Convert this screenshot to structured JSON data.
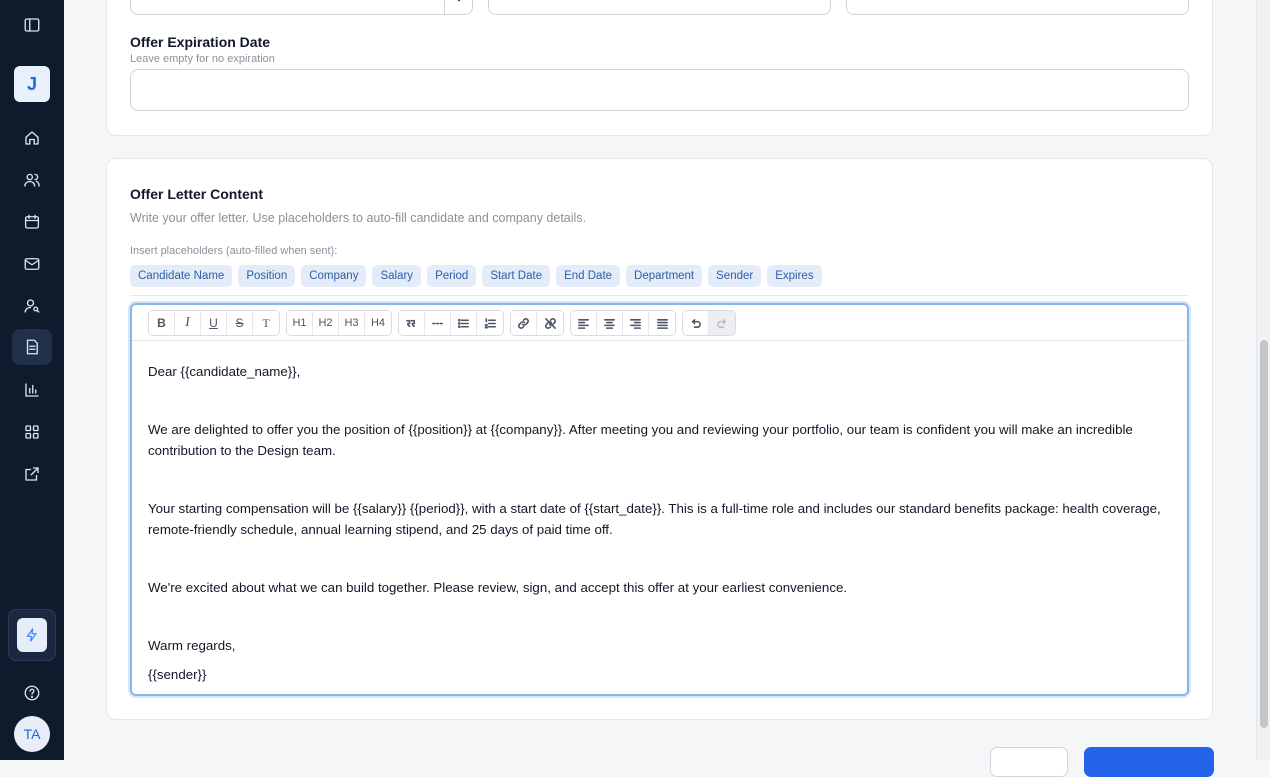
{
  "sidebar": {
    "logo_letter": "J",
    "user_initials": "TA",
    "items": [
      {
        "name": "toggle-sidebar-icon"
      },
      {
        "name": "home-icon"
      },
      {
        "name": "users-icon"
      },
      {
        "name": "calendar-icon"
      },
      {
        "name": "mail-icon"
      },
      {
        "name": "user-search-icon"
      },
      {
        "name": "document-icon",
        "active": true
      },
      {
        "name": "chart-icon"
      },
      {
        "name": "grid-icon"
      },
      {
        "name": "external-link-icon"
      },
      {
        "name": "help-icon"
      }
    ]
  },
  "expiration": {
    "label": "Offer Expiration Date",
    "help": "Leave empty for no expiration",
    "value": ""
  },
  "content": {
    "title": "Offer Letter Content",
    "subtitle": "Write your offer letter. Use placeholders to auto-fill candidate and company details.",
    "placeholder_label": "Insert placeholders (auto-filled when sent):",
    "placeholders": [
      "Candidate Name",
      "Position",
      "Company",
      "Salary",
      "Period",
      "Start Date",
      "End Date",
      "Department",
      "Sender",
      "Expires"
    ]
  },
  "toolbar": {
    "bold": "B",
    "italic": "I",
    "underline": "U",
    "strike": "S",
    "clear": "T",
    "h1": "H1",
    "h2": "H2",
    "h3": "H3",
    "h4": "H4"
  },
  "letter": {
    "greeting": "Dear {{candidate_name}},",
    "p1": "We are delighted to offer you the position of {{position}} at {{company}}. After meeting you and reviewing your portfolio, our team is confident you will make an incredible contribution to the Design team.",
    "p2": "Your starting compensation will be {{salary}} {{period}}, with a start date of {{start_date}}. This is a full-time role and includes our standard benefits package: health coverage, remote-friendly schedule, annual learning stipend, and 25 days of paid time off.",
    "p3": "We're excited about what we can build together. Please review, sign, and accept this offer at your earliest convenience.",
    "closing": "Warm regards,",
    "signature": "{{sender}}"
  },
  "colors": {
    "sidebar": "#0f1b2d",
    "accent": "#2563eb",
    "chip_bg": "#e3ecf8",
    "chip_text": "#2c5fa8"
  }
}
